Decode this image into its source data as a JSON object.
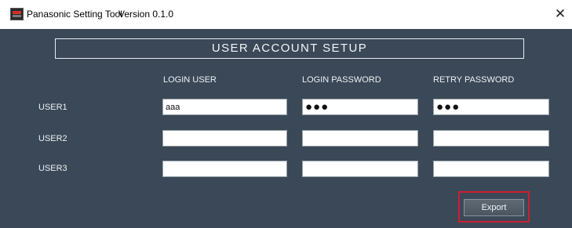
{
  "window": {
    "title": "Panasonic Setting Tool",
    "version": "Version 0.1.0",
    "close_glyph": "✕"
  },
  "header": {
    "title": "USER ACCOUNT SETUP"
  },
  "columns": {
    "login_user": "LOGIN USER",
    "login_password": "LOGIN PASSWORD",
    "retry_password": "RETRY PASSWORD"
  },
  "users": [
    {
      "label": "USER1",
      "login_user": "aaa",
      "login_password": "●●●",
      "retry_password": "●●●"
    },
    {
      "label": "USER2",
      "login_user": "",
      "login_password": "",
      "retry_password": ""
    },
    {
      "label": "USER3",
      "login_user": "",
      "login_password": "",
      "retry_password": ""
    }
  ],
  "actions": {
    "export_label": "Export"
  },
  "icons": {
    "app": "panasonic-app-icon",
    "close": "close-icon"
  },
  "colors": {
    "background": "#3b4857",
    "highlight": "#cc1f2e"
  }
}
